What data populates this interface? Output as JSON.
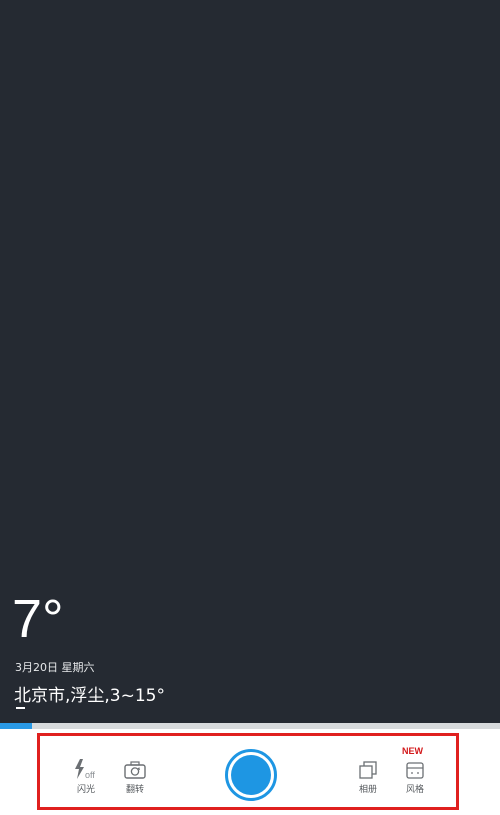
{
  "weather": {
    "temperature": "7°",
    "date": "3月20日  星期六",
    "location": "北京市,浮尘,3~15°"
  },
  "toolbar": {
    "flash": {
      "label": "闪光",
      "icon": "flash-off-icon"
    },
    "flip": {
      "label": "翻转",
      "icon": "camera-flip-icon"
    },
    "album": {
      "label": "相册",
      "icon": "album-icon"
    },
    "style": {
      "label": "风格",
      "icon": "style-icon",
      "badge": "NEW"
    }
  },
  "colors": {
    "viewfinder": "#252a32",
    "accent": "#1e96e3",
    "highlight": "#e0201f",
    "badge": "#d3181a"
  }
}
